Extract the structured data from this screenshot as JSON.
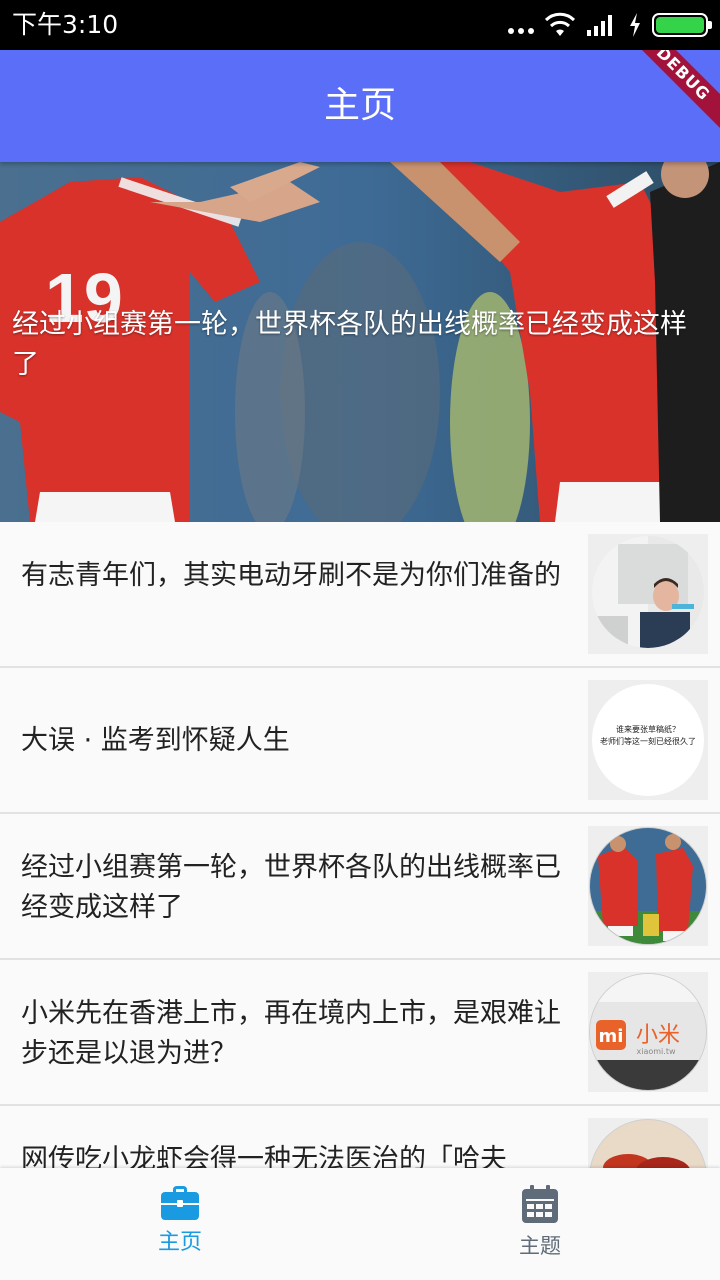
{
  "status_bar": {
    "time": "下午3:10",
    "icons": [
      "more-dots-icon",
      "wifi-icon",
      "signal-icon",
      "charging-icon",
      "battery-icon"
    ],
    "battery_color": "#35d34a"
  },
  "app_bar": {
    "title": "主页",
    "color": "#5b6ef7",
    "debug_banner": "DEBUG"
  },
  "hero": {
    "title": "经过小组赛第一轮，世界杯各队的出线概率已经变成这样了"
  },
  "articles": [
    {
      "title": "有志青年们，其实电动牙刷不是为你们准备的",
      "thumb": "toothbrush-photo"
    },
    {
      "title": "大误 · 监考到怀疑人生",
      "thumb": "exam-meme",
      "thumb_text": [
        "谁来要张草稿纸？",
        "老师们等这一刻已经很久了"
      ]
    },
    {
      "title": "经过小组赛第一轮，世界杯各队的出线概率已经变成这样了",
      "thumb": "worldcup-photo"
    },
    {
      "title": "小米先在香港上市，再在境内上市，是艰难让步还是以退为进？",
      "thumb": "xiaomi-logo",
      "thumb_text": [
        "小米",
        "xiaomi.tw"
      ]
    },
    {
      "title": "网传吃小龙虾会得一种无法医治的「哈夫",
      "thumb": "crayfish-photo"
    }
  ],
  "bottom_nav": {
    "items": [
      {
        "label": "主页",
        "icon": "briefcase-icon",
        "active": true
      },
      {
        "label": "主题",
        "icon": "calendar-icon",
        "active": false
      }
    ],
    "active_color": "#1a9ae0",
    "inactive_color": "#5f6b78"
  }
}
